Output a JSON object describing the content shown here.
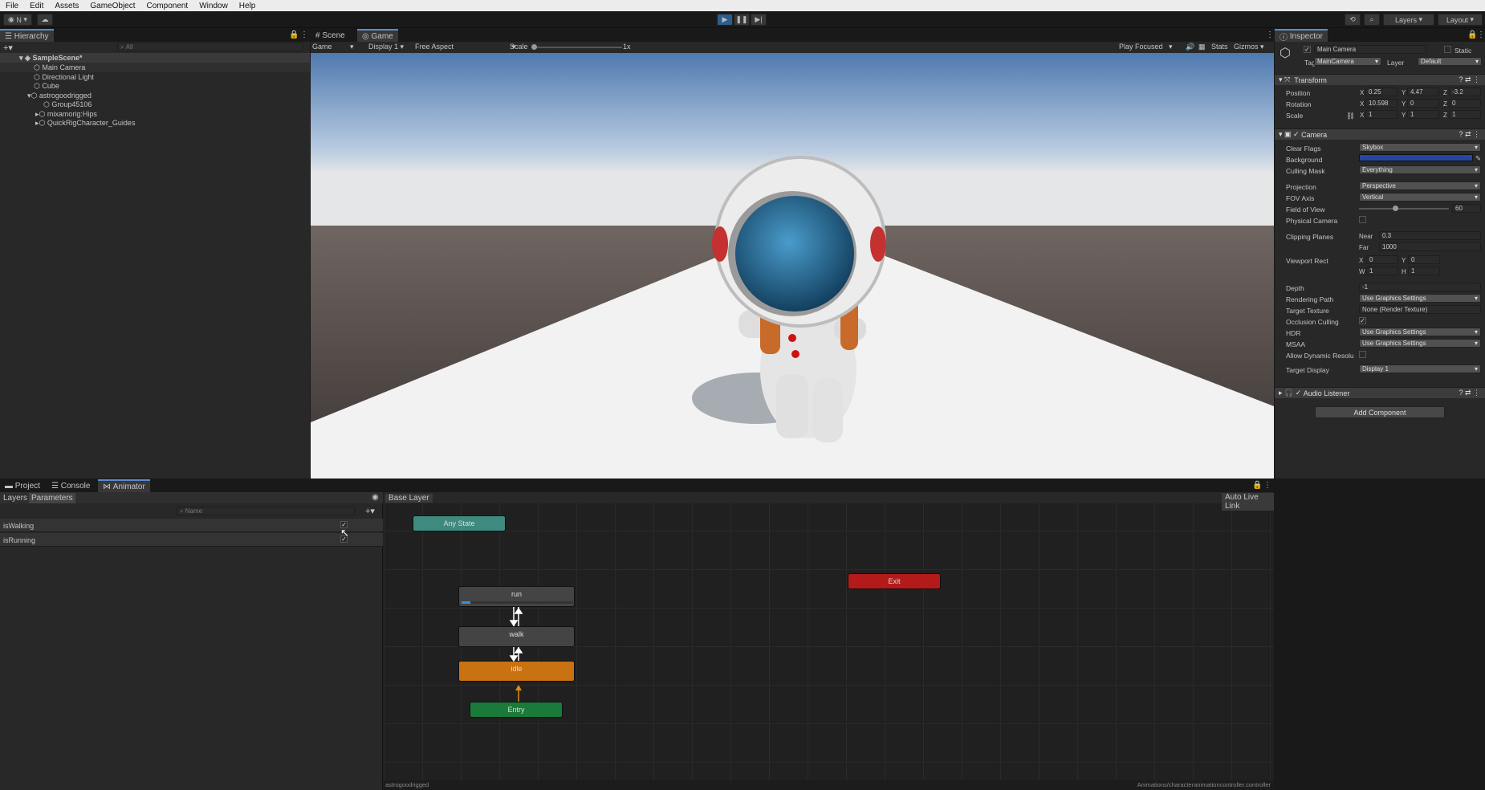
{
  "menu": [
    "File",
    "Edit",
    "Assets",
    "GameObject",
    "Component",
    "Window",
    "Help"
  ],
  "toolbar": {
    "account": "N",
    "layers": "Layers",
    "layout": "Layout"
  },
  "hierarchy": {
    "title": "Hierarchy",
    "search": "All",
    "scene": "SampleScene*",
    "items": [
      "Main Camera",
      "Directional Light",
      "Cube",
      "astrogoodrigged",
      "Group45106",
      "mixamorig:Hips",
      "QuickRigCharacter_Guides"
    ]
  },
  "scene_tabs": {
    "scene": "Scene",
    "game": "Game"
  },
  "game_bar": {
    "view": "Game",
    "display": "Display 1",
    "aspect": "Free Aspect",
    "scale_label": "Scale",
    "scale_value": "1x",
    "play_focused": "Play Focused",
    "stats": "Stats",
    "gizmos": "Gizmos"
  },
  "inspector": {
    "title": "Inspector",
    "object": "Main Camera",
    "static": "Static",
    "tag_label": "Tag",
    "tag": "MainCamera",
    "layer_label": "Layer",
    "layer": "Default",
    "transform": {
      "title": "Transform",
      "position": "Position",
      "rotation": "Rotation",
      "scale": "Scale",
      "pos": [
        "0.25",
        "4.47",
        "-3.2"
      ],
      "rot": [
        "10.598",
        "0",
        "0"
      ],
      "scl": [
        "1",
        "1",
        "1"
      ]
    },
    "camera": {
      "title": "Camera",
      "clear_flags": "Clear Flags",
      "clear_flags_val": "Skybox",
      "background": "Background",
      "culling_mask": "Culling Mask",
      "culling_mask_val": "Everything",
      "projection": "Projection",
      "projection_val": "Perspective",
      "fov_axis": "FOV Axis",
      "fov_axis_val": "Vertical",
      "fov": "Field of View",
      "fov_val": "60",
      "fov_fraction": 0.4,
      "physical": "Physical Camera",
      "clipping": "Clipping Planes",
      "near": "Near",
      "near_val": "0.3",
      "far": "Far",
      "far_val": "1000",
      "viewport": "Viewport Rect",
      "vx": "0",
      "vy": "0",
      "vw": "1",
      "vh": "1",
      "depth": "Depth",
      "depth_val": "-1",
      "rendering_path": "Rendering Path",
      "rendering_path_val": "Use Graphics Settings",
      "target_texture": "Target Texture",
      "target_texture_val": "None (Render Texture)",
      "occlusion": "Occlusion Culling",
      "hdr": "HDR",
      "hdr_val": "Use Graphics Settings",
      "msaa": "MSAA",
      "msaa_val": "Use Graphics Settings",
      "dynres": "Allow Dynamic Resolu",
      "target_display": "Target Display",
      "target_display_val": "Display 1"
    },
    "audio": {
      "title": "Audio Listener"
    },
    "add_component": "Add Component"
  },
  "bottom_tabs": {
    "project": "Project",
    "console": "Console",
    "animator": "Animator"
  },
  "animator": {
    "layers": "Layers",
    "parameters": "Parameters",
    "name_placeholder": "Name",
    "params": [
      "isWalking",
      "isRunning"
    ],
    "base_layer": "Base Layer",
    "auto_live": "Auto Live Link",
    "states": {
      "any": "Any State",
      "exit": "Exit",
      "run": "run",
      "walk": "walk",
      "idle": "idle",
      "entry": "Entry"
    },
    "run_progress": 0.08,
    "footer_left": "astrogoodrigged",
    "footer_right": "Animations/characteranimationcontroller.controller"
  },
  "colors": {
    "accent": "#5a8bd0",
    "idle": "#c97212",
    "entry": "#1a7a3a",
    "exit": "#b31a1a",
    "any": "#3e8a7f"
  }
}
